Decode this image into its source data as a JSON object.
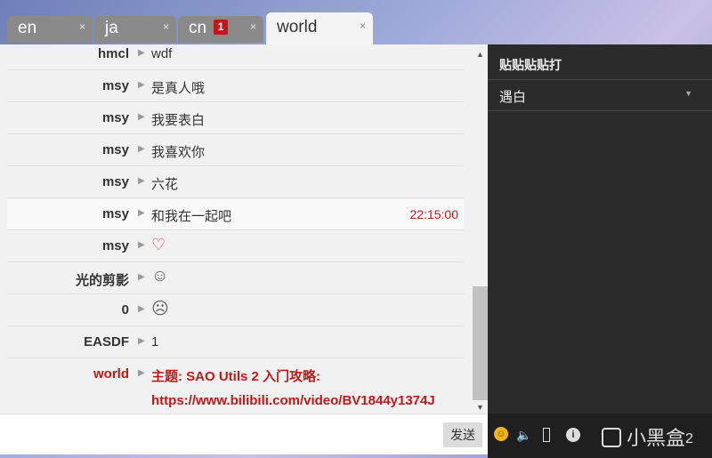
{
  "tabs": [
    {
      "label": "en",
      "close": "×"
    },
    {
      "label": "ja",
      "close": "×"
    },
    {
      "label": "cn",
      "badge": "1",
      "close": "×"
    },
    {
      "label": "world",
      "close": "×"
    }
  ],
  "messages": [
    {
      "user": "hmcl",
      "text": "wdf"
    },
    {
      "user": "msy",
      "text": "是真人哦"
    },
    {
      "user": "msy",
      "text": "我要表白"
    },
    {
      "user": "msy",
      "text": "我喜欢你"
    },
    {
      "user": "msy",
      "text": "六花"
    },
    {
      "user": "msy",
      "text": "和我在一起吧",
      "time": "22:15:00"
    },
    {
      "user": "msy",
      "text": "♡"
    },
    {
      "user": "光的剪影",
      "text": "☺"
    },
    {
      "user": "0",
      "text": "☹"
    },
    {
      "user": "EASDF",
      "text": "1"
    },
    {
      "user": "world",
      "text": "主题: SAO Utils 2 入门攻略:",
      "text2": "https://www.bilibili.com/video/BV1844y1374J"
    }
  ],
  "send_label": "发送",
  "panel": {
    "title": "贴贴贴贴打",
    "select_value": "遇白"
  },
  "toolbar": {
    "logo_text": "小黑盒",
    "logo_count": "2"
  },
  "colors": {
    "accent": "#c01818",
    "panel_bg": "#2b2b2b"
  }
}
